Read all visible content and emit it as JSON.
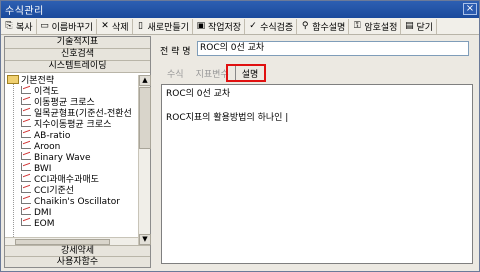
{
  "window": {
    "title": "수식관리",
    "close_glyph": "×"
  },
  "toolbar": {
    "items": [
      {
        "label": "복사",
        "icon": "copy-icon",
        "glyph": "⎘"
      },
      {
        "label": "이름바꾸기",
        "icon": "rename-icon",
        "glyph": "▭"
      },
      {
        "label": "삭제",
        "icon": "delete-icon",
        "glyph": "✕"
      },
      {
        "label": "새로만들기",
        "icon": "new-icon",
        "glyph": "▯"
      },
      {
        "label": "작업저장",
        "icon": "save-icon",
        "glyph": "▣"
      },
      {
        "label": "수식검증",
        "icon": "verify-icon",
        "glyph": "✓"
      },
      {
        "label": "함수설명",
        "icon": "function-help-icon",
        "glyph": "⚲"
      },
      {
        "label": "암호설정",
        "icon": "key-icon",
        "glyph": "⚿"
      },
      {
        "label": "닫기",
        "icon": "close-icon",
        "glyph": "▤"
      }
    ]
  },
  "left": {
    "tabs": [
      "기술적지표",
      "신호검색",
      "시스템트레이딩"
    ],
    "tree": {
      "root": "기본전략",
      "items": [
        "이격도",
        "이동평균 크로스",
        "일목균형표(기준선-전환선",
        "지수이동평균 크로스",
        "AB-ratio",
        "Aroon",
        "Binary Wave",
        "BWI",
        "CCI과매수과매도",
        "CCI기준선",
        "Chaikin's Oscillator",
        "DMI",
        "EOM"
      ]
    },
    "bottom_tabs": [
      "강세약세",
      "사용자함수"
    ]
  },
  "right": {
    "name_label": "전 략 명",
    "name_value": "ROC의 0선 교차",
    "tabs": [
      "수식",
      "지표변수",
      "설명"
    ],
    "active_tab": "설명",
    "editor_lines": [
      "ROC의 0선 교차",
      "",
      "ROC지표의 활용방법의 하나인 |"
    ]
  }
}
